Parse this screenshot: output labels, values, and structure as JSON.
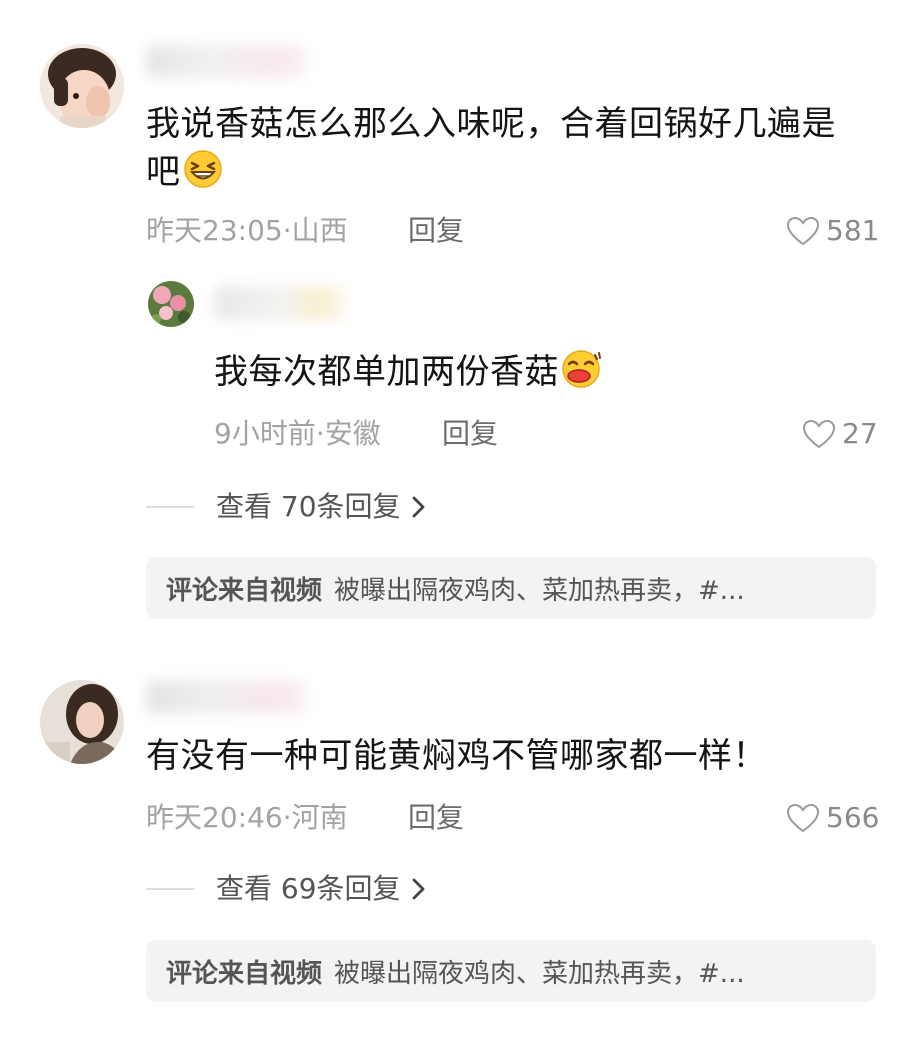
{
  "comments": [
    {
      "text_line1": "我说香菇怎么那么入味呢，合着回锅好几遍是",
      "text_line2": "吧",
      "emoji_icon": "laughing-squint-emoji",
      "time_location": "昨天23:05·山西",
      "reply_label": "回复",
      "likes": "581",
      "sub_reply": {
        "text": "我每次都单加两份香菇",
        "emoji_icon": "drooling-emoji",
        "time_location": "9小时前·安徽",
        "reply_label": "回复",
        "likes": "27"
      },
      "view_replies": "查看 70条回复",
      "source_label": "评论来自视频",
      "source_text": "被曝出隔夜鸡肉、菜加热再卖，#..."
    },
    {
      "text_line1": "有没有一种可能黄焖鸡不管哪家都一样！",
      "time_location": "昨天20:46·河南",
      "reply_label": "回复",
      "likes": "566",
      "view_replies": "查看 69条回复",
      "source_label": "评论来自视频",
      "source_text": "被曝出隔夜鸡肉、菜加热再卖，#..."
    }
  ],
  "colors": {
    "meta": "#a3a3a3",
    "reply": "#6c6c6c",
    "source_bg": "#f3f3f3"
  }
}
